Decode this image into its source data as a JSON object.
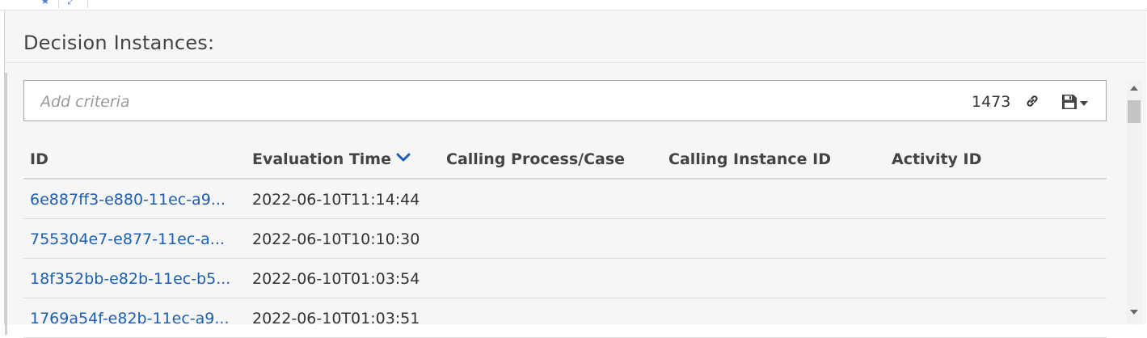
{
  "top_tabs": [
    {
      "icon": "star-icon",
      "glyph": "★"
    },
    {
      "icon": "refresh-icon",
      "glyph": "⤢"
    }
  ],
  "panel": {
    "title": "Decision Instances:"
  },
  "search": {
    "placeholder": "Add criteria",
    "value": "",
    "count": "1473",
    "link_icon": "link-icon",
    "save_icon": "floppy-disk-icon",
    "save_dropdown_icon": "caret-down-icon"
  },
  "table": {
    "columns": [
      {
        "label": "ID"
      },
      {
        "label": "Evaluation Time",
        "sort": "descending"
      },
      {
        "label": "Calling Process/Case"
      },
      {
        "label": "Calling Instance ID"
      },
      {
        "label": "Activity ID"
      }
    ],
    "rows": [
      {
        "id": "6e887ff3-e880-11ec-a9...",
        "evaluation_time": "2022-06-10T11:14:44",
        "calling_process": "",
        "calling_instance_id": "",
        "activity_id": ""
      },
      {
        "id": "755304e7-e877-11ec-a...",
        "evaluation_time": "2022-06-10T10:10:30",
        "calling_process": "",
        "calling_instance_id": "",
        "activity_id": ""
      },
      {
        "id": "18f352bb-e82b-11ec-b5...",
        "evaluation_time": "2022-06-10T01:03:54",
        "calling_process": "",
        "calling_instance_id": "",
        "activity_id": ""
      },
      {
        "id": "1769a54f-e82b-11ec-a9...",
        "evaluation_time": "2022-06-10T01:03:51",
        "calling_process": "",
        "calling_instance_id": "",
        "activity_id": ""
      }
    ]
  },
  "colors": {
    "link": "#1a5fb4",
    "sort_arrow": "#1a5fb4",
    "panel_bg": "#f6f6f6"
  }
}
